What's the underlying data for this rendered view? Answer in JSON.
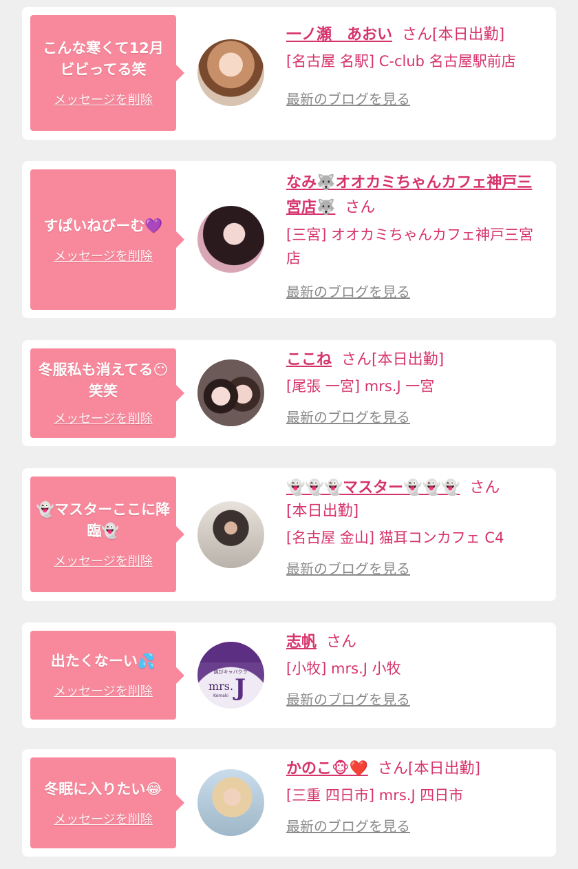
{
  "colors": {
    "accent": "#d6336c",
    "bubble": "#f8899c",
    "card": "#ffffff",
    "background": "#efefef",
    "link_gray": "#8a8a8a"
  },
  "items": [
    {
      "message": "こんな寒くて12月ビビってる笑",
      "delete_label": "メッセージを削除",
      "name": "一ノ瀬　あおい",
      "honorific": "さん",
      "status": "[本日出勤]",
      "shop": "[名古屋 名駅] C-club 名古屋駅前店",
      "blog_label": "最新のブログを見る"
    },
    {
      "message": "すぱいねびーむ💜",
      "delete_label": "メッセージを削除",
      "name": "なみ🐺オオカミちゃんカフェ神戸三宮店🐺",
      "honorific": "さん",
      "status": "",
      "shop": "[三宮] オオカミちゃんカフェ神戸三宮店",
      "blog_label": "最新のブログを見る"
    },
    {
      "message": "冬服私も消えてる😶笑笑",
      "delete_label": "メッセージを削除",
      "name": "ここね",
      "honorific": "さん",
      "status": "[本日出勤]",
      "shop": "[尾張 一宮] mrs.J 一宮",
      "blog_label": "最新のブログを見る"
    },
    {
      "message": "👻マスターここに降臨👻",
      "delete_label": "メッセージを削除",
      "name": "👻👻👻マスター👻👻👻",
      "honorific": "さん",
      "status": "[本日出勤]",
      "shop": "[名古屋 金山] 猫耳コンカフェ C4",
      "blog_label": "最新のブログを見る"
    },
    {
      "message": "出たくなーい💦",
      "delete_label": "メッセージを削除",
      "name": "志帆",
      "honorific": "さん",
      "status": "",
      "shop": "[小牧] mrs.J 小牧",
      "blog_label": "最新のブログを見る",
      "logo_top": "跳びキャバクラ",
      "logo_mark": "mrs.",
      "logo_letter": "J",
      "logo_sub": "Komaki"
    },
    {
      "message": "冬眠に入りたい😂",
      "delete_label": "メッセージを削除",
      "name": "かのこ🐵❤️",
      "honorific": "さん",
      "status": "[本日出勤]",
      "shop": "[三重 四日市] mrs.J 四日市",
      "blog_label": "最新のブログを見る"
    }
  ]
}
